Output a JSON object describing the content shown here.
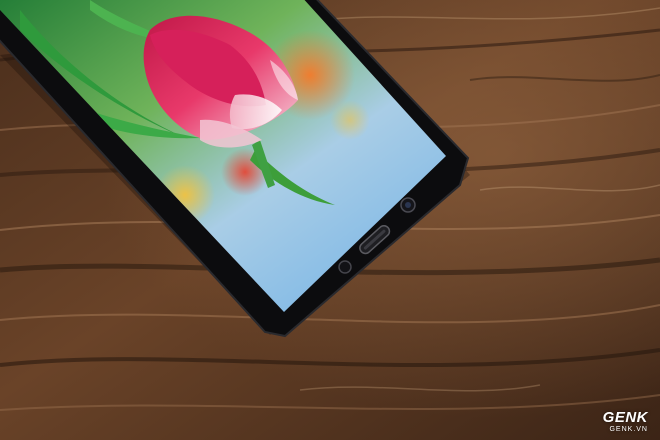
{
  "photo": {
    "subject": "smartphone-on-wooden-table",
    "wallpaper": "pink-tulip",
    "colors": {
      "wood_dark": "#2b1a10",
      "wood_mid": "#6a4328",
      "wood_light": "#a17553",
      "phone_body": "#0c0c0e",
      "screen_sky": "#8fc3ec",
      "tulip_pink": "#e0285a",
      "leaf_green": "#2f9a3c",
      "bokeh_orange": "#f08a2a"
    }
  },
  "watermark": {
    "brand": "GENK",
    "site": "GENK.VN"
  }
}
